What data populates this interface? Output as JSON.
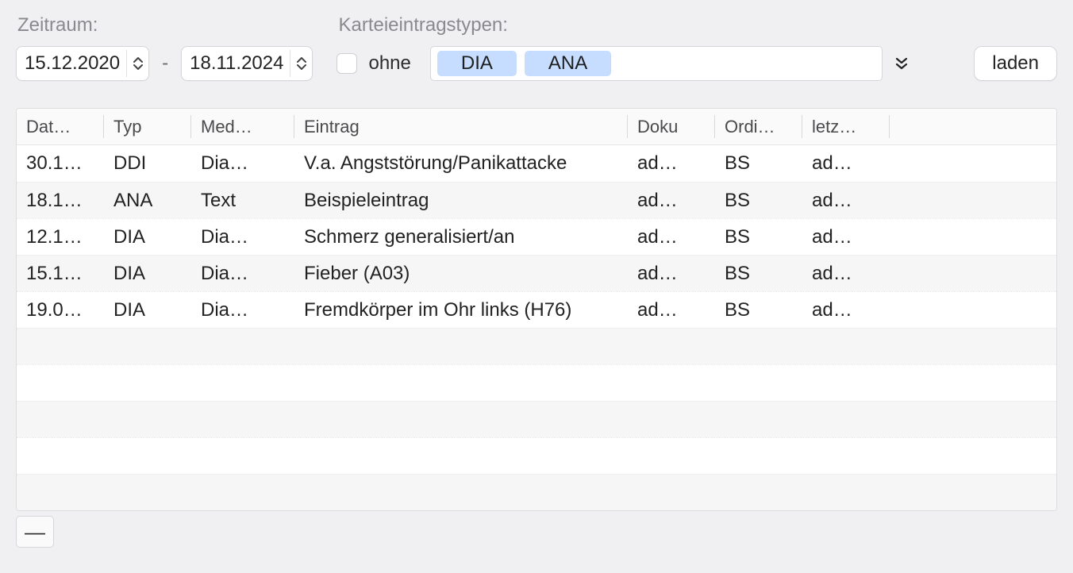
{
  "toolbar": {
    "zeitraum_label": "Zeitraum:",
    "date_from": "15.12.2020",
    "date_to": "18.11.2024",
    "date_sep": "-",
    "types_label": "Karteieintragstypen:",
    "ohne_label": "ohne",
    "tags": [
      "DIA",
      "ANA"
    ],
    "load_label": "laden"
  },
  "table": {
    "headers": [
      "Dat…",
      "Typ",
      "Med…",
      "Eintrag",
      "Doku",
      "Ordi…",
      "letz…",
      ""
    ],
    "rows": [
      {
        "date": "30.1…",
        "typ": "DDI",
        "med": "Dia…",
        "eintrag": "V.a. Angststörung/Panikattacke",
        "doku": "ad…",
        "ordi": "BS",
        "letz": "ad…"
      },
      {
        "date": "18.1…",
        "typ": "ANA",
        "med": "Text",
        "eintrag": "Beispieleintrag",
        "doku": "ad…",
        "ordi": "BS",
        "letz": "ad…"
      },
      {
        "date": "12.1…",
        "typ": "DIA",
        "med": "Dia…",
        "eintrag": "Schmerz generalisiert/an",
        "doku": "ad…",
        "ordi": "BS",
        "letz": "ad…"
      },
      {
        "date": "15.1…",
        "typ": "DIA",
        "med": "Dia…",
        "eintrag": "Fieber (A03)",
        "doku": "ad…",
        "ordi": "BS",
        "letz": "ad…"
      },
      {
        "date": "19.0…",
        "typ": "DIA",
        "med": "Dia…",
        "eintrag": "Fremdkörper im Ohr links (H76)",
        "doku": "ad…",
        "ordi": "BS",
        "letz": "ad…"
      }
    ],
    "empty_rows": 5
  },
  "footer": {
    "minus_label": "—"
  }
}
